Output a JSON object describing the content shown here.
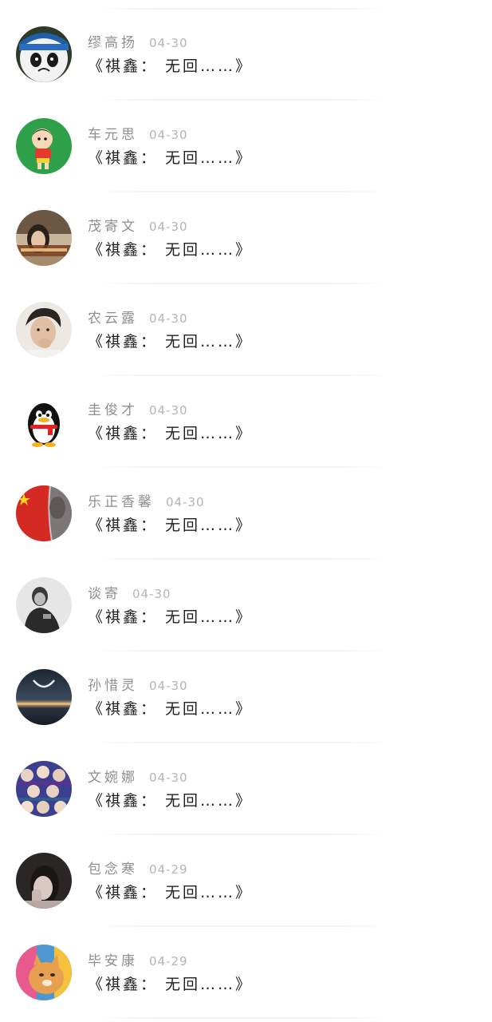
{
  "comments": [
    {
      "name": "缪高扬",
      "date": "04-30",
      "message": "《祺鑫： 无回……》",
      "avatar": "panda-cartoon-avatar"
    },
    {
      "name": "车元思",
      "date": "04-30",
      "message": "《祺鑫： 无回……》",
      "avatar": "cartoon-boy-avatar"
    },
    {
      "name": "茂寄文",
      "date": "04-30",
      "message": "《祺鑫： 无回……》",
      "avatar": "girl-photo-avatar"
    },
    {
      "name": "农云露",
      "date": "04-30",
      "message": "《祺鑫： 无回……》",
      "avatar": "boy-photo-avatar"
    },
    {
      "name": "圭俊才",
      "date": "04-30",
      "message": "《祺鑫： 无回……》",
      "avatar": "penguin-avatar"
    },
    {
      "name": "乐正香馨",
      "date": "04-30",
      "message": "《祺鑫： 无回……》",
      "avatar": "flag-photo-avatar"
    },
    {
      "name": "谈寄",
      "date": "04-30",
      "message": "《祺鑫： 无回……》",
      "avatar": "bw-boy-photo-avatar"
    },
    {
      "name": "孙惜灵",
      "date": "04-30",
      "message": "《祺鑫： 无回……》",
      "avatar": "moon-landscape-avatar"
    },
    {
      "name": "文婉娜",
      "date": "04-30",
      "message": "《祺鑫： 无回……》",
      "avatar": "anime-group-avatar"
    },
    {
      "name": "包念寒",
      "date": "04-29",
      "message": "《祺鑫： 无回……》",
      "avatar": "dark-girl-photo-avatar"
    },
    {
      "name": "毕安康",
      "date": "04-29",
      "message": "《祺鑫： 无回……》",
      "avatar": "cat-photo-avatar"
    }
  ],
  "colors": {
    "name_text": "#8e8e8e",
    "date_text": "#b4b4b4",
    "message_text": "#1e1e1e",
    "divider": "#eef3ee"
  }
}
